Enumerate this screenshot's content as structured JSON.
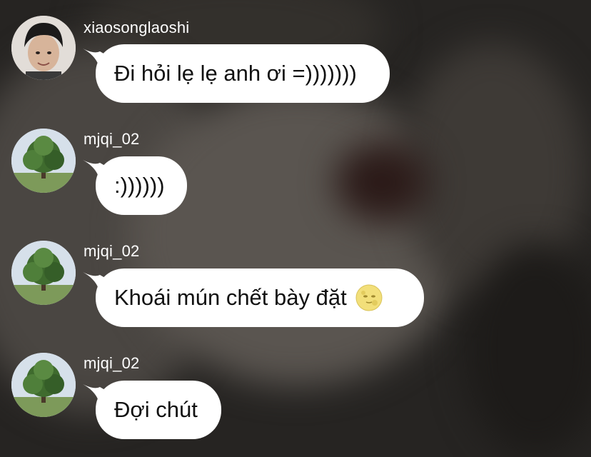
{
  "messages": [
    {
      "username": "xiaosonglaoshi",
      "avatar": "person-avatar",
      "text": "Đi hỏi lẹ lẹ anh ơi =)))))))",
      "emoji": null
    },
    {
      "username": "mjqi_02",
      "avatar": "tree-avatar",
      "text": ":))))))",
      "emoji": null
    },
    {
      "username": "mjqi_02",
      "avatar": "tree-avatar",
      "text": "Khoái mún chết bày đặt",
      "emoji": "full-moon-face"
    },
    {
      "username": "mjqi_02",
      "avatar": "tree-avatar",
      "text": "Đợi chút",
      "emoji": null
    }
  ],
  "colors": {
    "bubble": "#ffffff",
    "text": "#111111",
    "username": "#ffffff",
    "background": "#262422"
  }
}
